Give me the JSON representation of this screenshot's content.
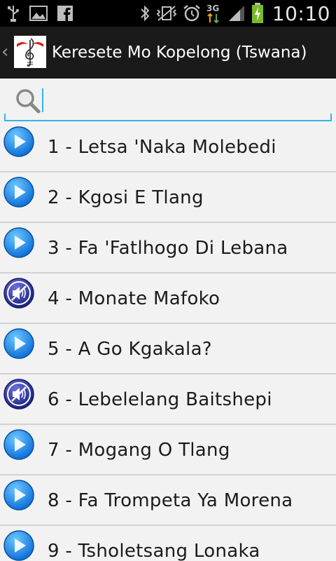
{
  "status_bar": {
    "time": "10:10",
    "network": "3G",
    "left_icons": [
      "usb-icon",
      "image-icon",
      "facebook-icon"
    ],
    "right_icons": [
      "bluetooth-icon",
      "vibrate-icon",
      "alarm-icon",
      "network-3g-icon",
      "signal-icon",
      "battery-charging-icon"
    ]
  },
  "action_bar": {
    "title": "Keresete Mo Kopelong (Tswana)",
    "back_icon": "chevron-left-icon",
    "logo_icon": "treble-clef-logo"
  },
  "search": {
    "value": "",
    "placeholder": "",
    "icon": "search-icon"
  },
  "songs": [
    {
      "label": "1 - Letsa 'Naka Molebedi",
      "icon": "play-icon"
    },
    {
      "label": "2 - Kgosi E Tlang",
      "icon": "play-icon"
    },
    {
      "label": "3 - Fa 'Fatlhogo Di Lebana",
      "icon": "play-icon"
    },
    {
      "label": "4 - Monate Mafoko",
      "icon": "mute-icon"
    },
    {
      "label": "5 - A Go Kgakala?",
      "icon": "play-icon"
    },
    {
      "label": "6 - Lebelelang Baitshepi",
      "icon": "mute-icon"
    },
    {
      "label": "7 - Mogang O Tlang",
      "icon": "play-icon"
    },
    {
      "label": "8 - Fa Trompeta Ya Morena",
      "icon": "play-icon"
    },
    {
      "label": "9 - Tsholetsang Lonaka",
      "icon": "play-icon"
    }
  ],
  "colors": {
    "play_blue": "#1f8ff0",
    "mute_navy": "#2a2f8f",
    "accent_cyan": "#33b5e5",
    "action_bar": "#1a1a1a"
  }
}
